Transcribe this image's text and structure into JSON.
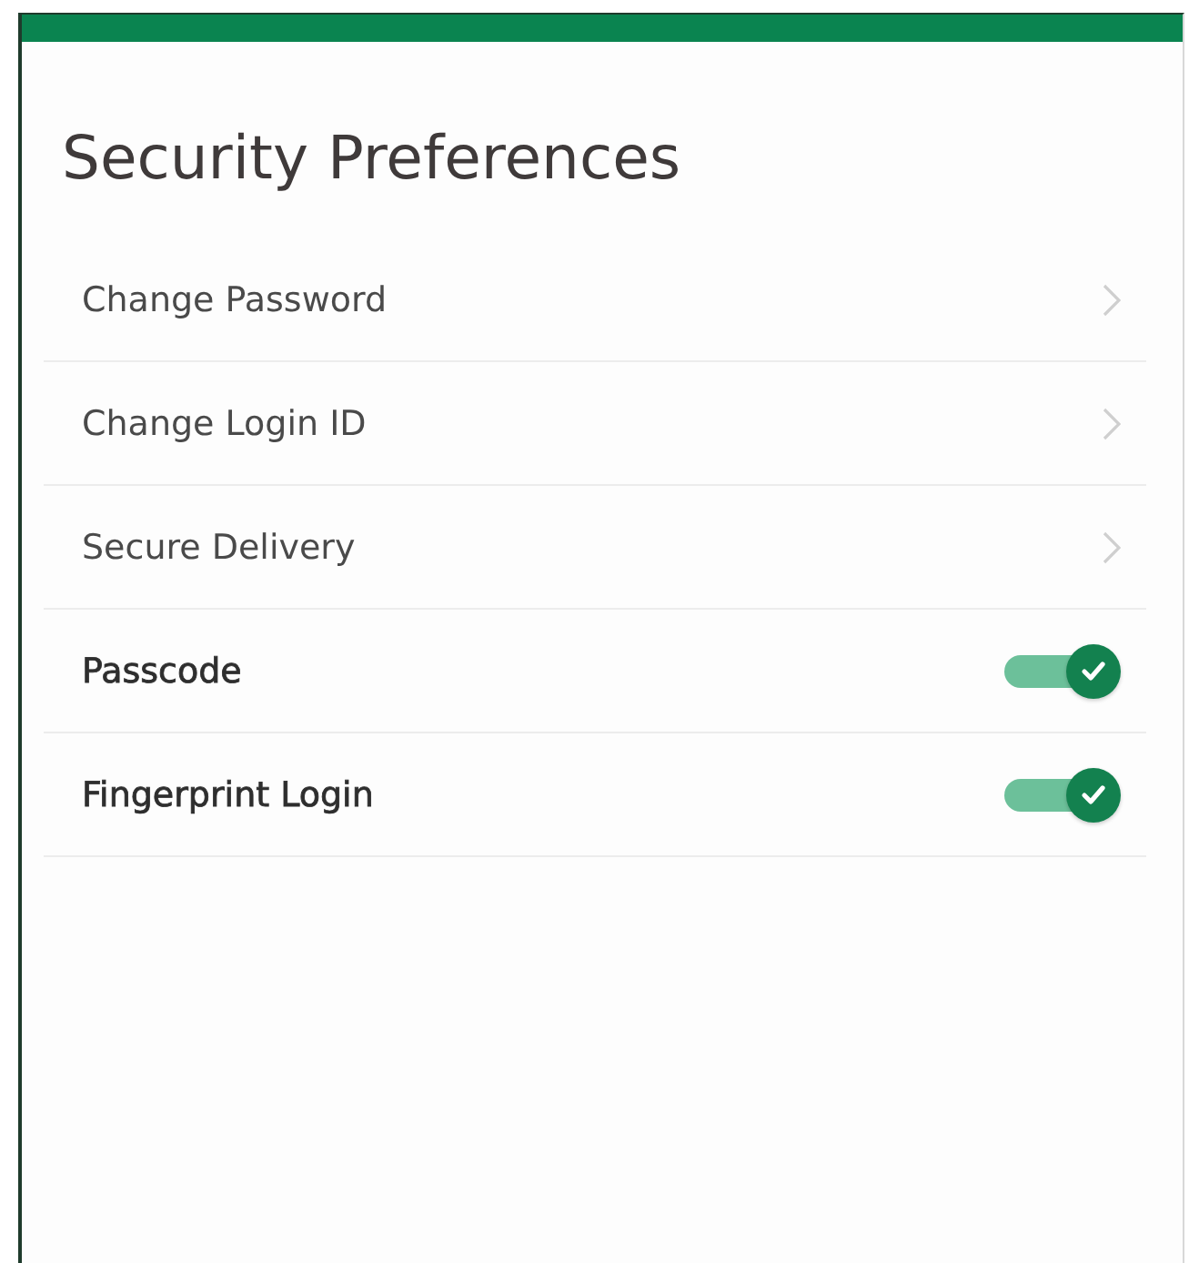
{
  "title": "Security Preferences",
  "items": [
    {
      "label": "Change Password",
      "kind": "link"
    },
    {
      "label": "Change Login ID",
      "kind": "link"
    },
    {
      "label": "Secure Delivery",
      "kind": "link"
    },
    {
      "label": "Passcode",
      "kind": "toggle",
      "on": true
    },
    {
      "label": "Fingerprint Login",
      "kind": "toggle",
      "on": true
    }
  ]
}
